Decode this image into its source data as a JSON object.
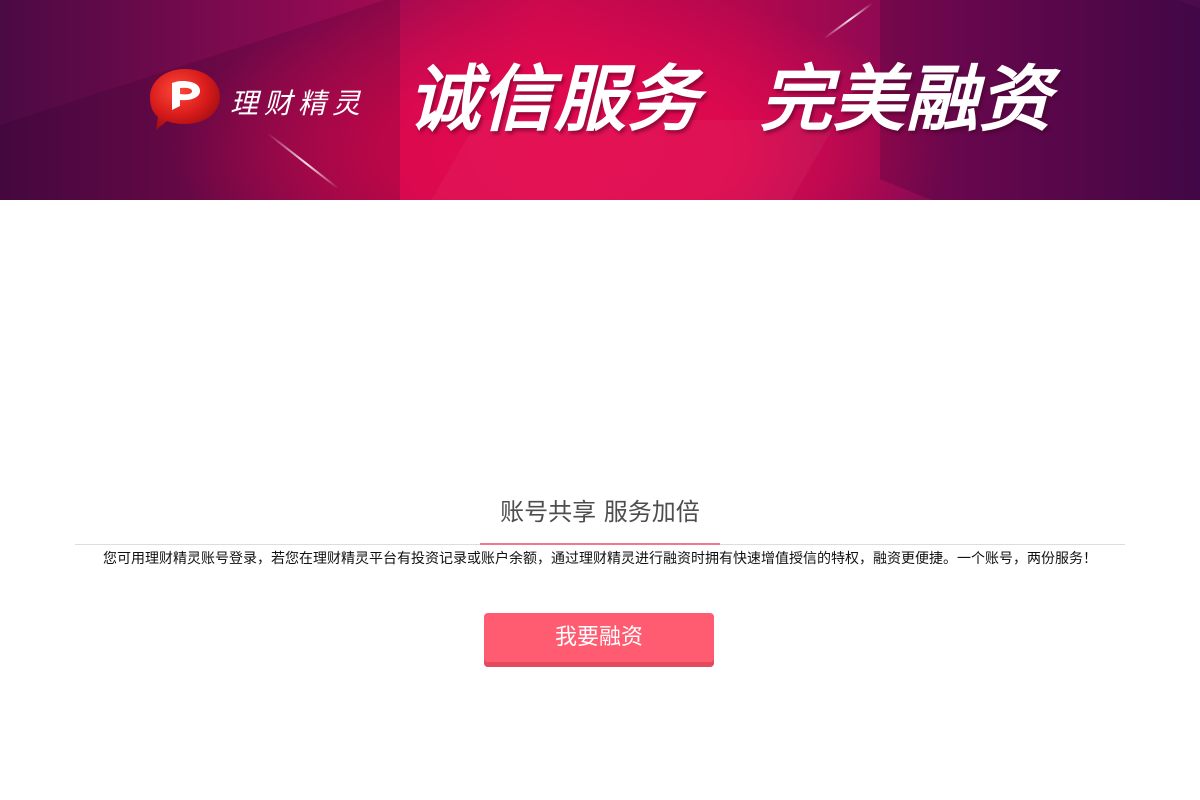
{
  "banner": {
    "logo_text": "理财精灵",
    "slogan_left": "诚信服务",
    "slogan_right": "完美融资"
  },
  "main": {
    "title": "账号共享 服务加倍",
    "description": "您可用理财精灵账号登录，若您在理财精灵平台有投资记录或账户余额，通过理财精灵进行融资时拥有快速增值授信的特权，融资更便捷。一个账号，两份服务！",
    "apply_button_label": "我要融资"
  },
  "colors": {
    "accent": "#ff5b71",
    "banner_primary": "#c9094c",
    "banner_dark": "#4a0a44"
  }
}
